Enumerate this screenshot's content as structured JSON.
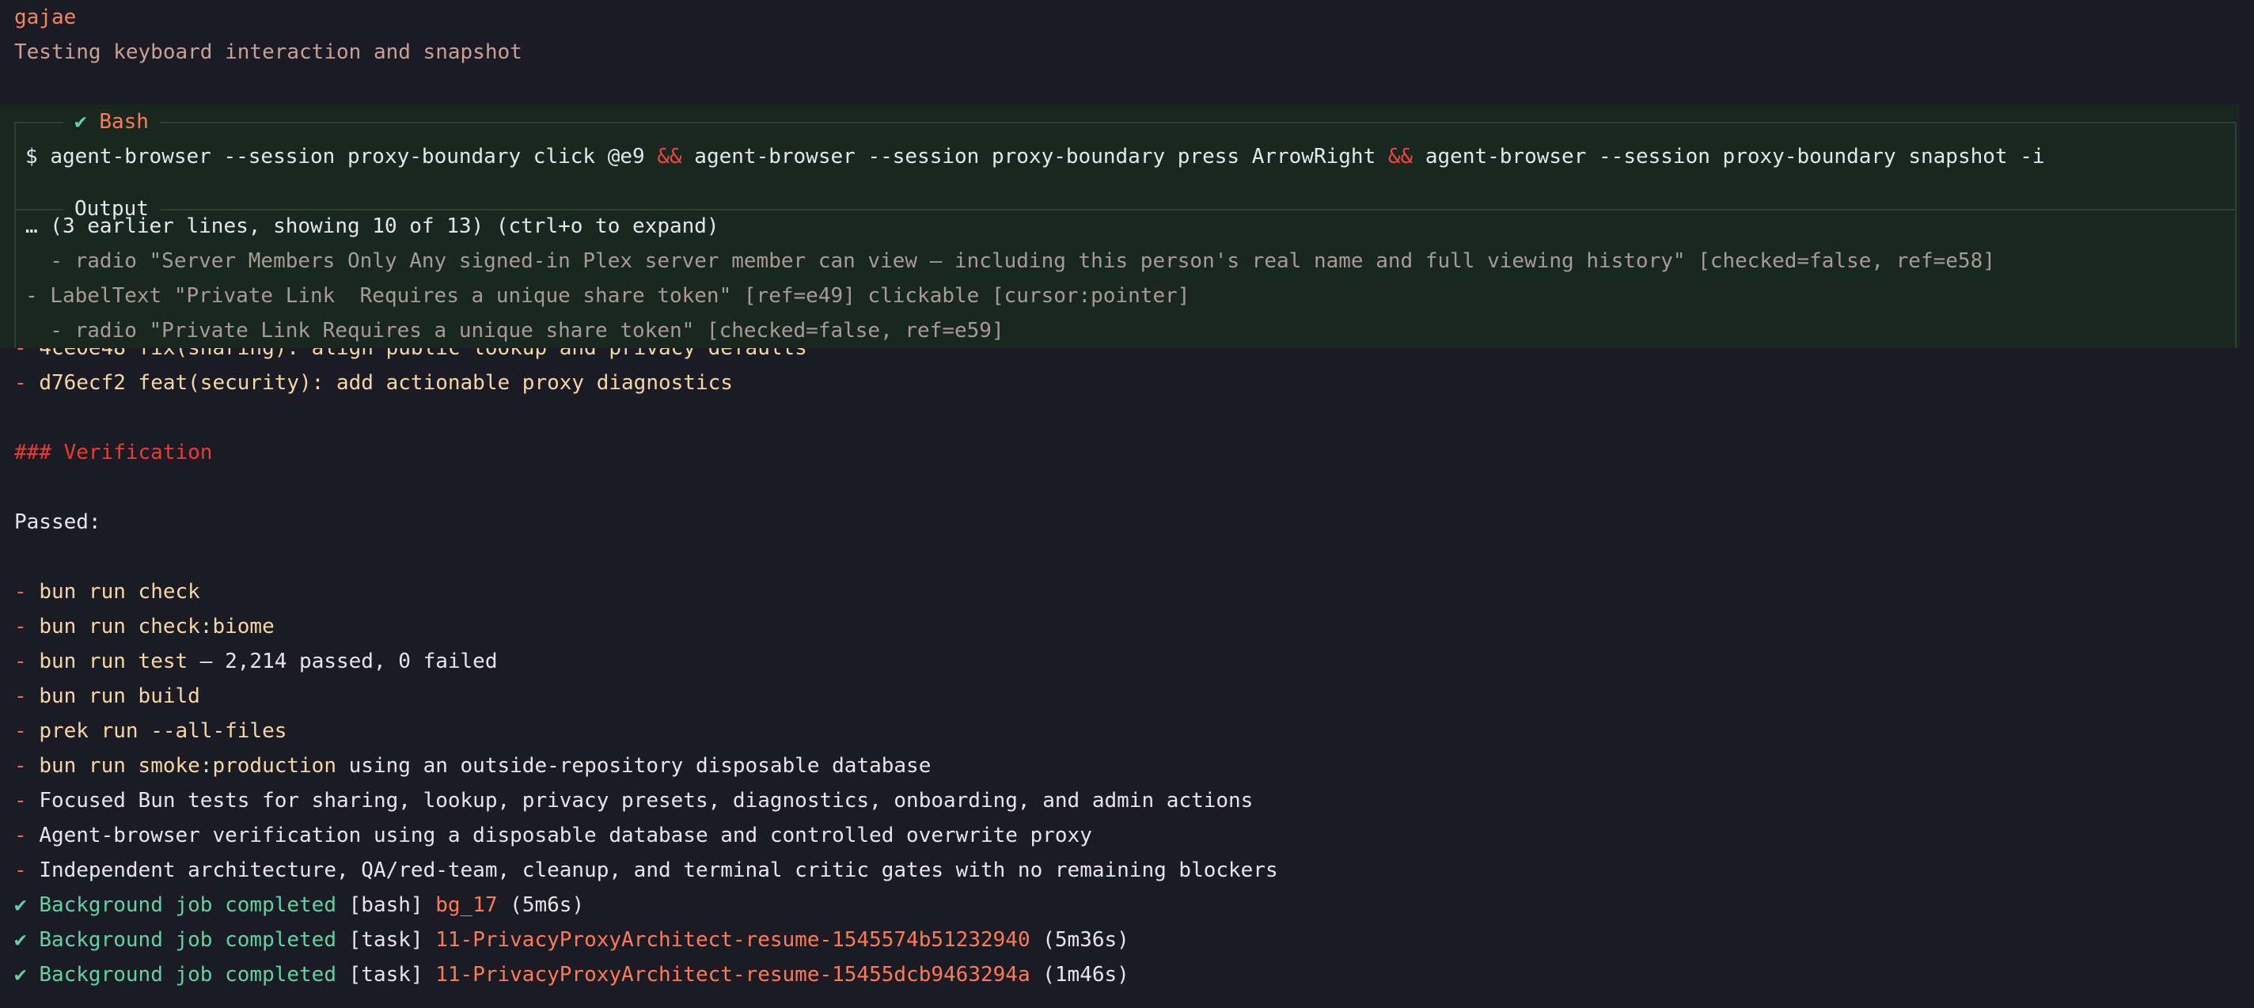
{
  "header": {
    "user": "gajae",
    "status": "Testing keyboard interaction and snapshot"
  },
  "tool": {
    "check": "✔",
    "name": "Bash",
    "output_label": "Output",
    "prompt": "$",
    "command_parts": [
      "agent-browser --session proxy-boundary click @e9",
      "&&",
      "agent-browser --session proxy-boundary press ArrowRight",
      "&&",
      "agent-browser --session proxy-boundary snapshot -i"
    ],
    "output_lines": [
      "… (3 earlier lines, showing 10 of 13) (ctrl+o to expand)",
      "  - radio \"Server Members Only Any signed-in Plex server member can view — including this person's real name and full viewing history\" [checked=false, ref=e58]",
      "- LabelText \"Private Link  Requires a unique share token\" [ref=e49] clickable [cursor:pointer]",
      "  - radio \"Private Link Requires a unique share token\" [checked=false, ref=e59]"
    ]
  },
  "commits": [
    "4ce0e48 fix(sharing): align public lookup and privacy defaults",
    "d76ecf2 feat(security): add actionable proxy diagnostics"
  ],
  "verification": {
    "heading": "### Verification",
    "passed_label": "Passed:",
    "items": [
      {
        "cmd": "bun run check",
        "rest": ""
      },
      {
        "cmd": "bun run check:biome",
        "rest": ""
      },
      {
        "cmd": "bun run test",
        "rest": " — 2,214 passed, 0 failed"
      },
      {
        "cmd": "bun run build",
        "rest": ""
      },
      {
        "cmd": "prek run --all-files",
        "rest": ""
      },
      {
        "cmd": "bun run smoke:production",
        "rest": " using an outside-repository disposable database"
      },
      {
        "cmd": "",
        "rest": "Focused Bun tests for sharing, lookup, privacy presets, diagnostics, onboarding, and admin actions"
      },
      {
        "cmd": "",
        "rest": "Agent-browser verification using a disposable database and controlled overwrite proxy"
      },
      {
        "cmd": "",
        "rest": "Independent architecture, QA/red-team, cleanup, and terminal critic gates with no remaining blockers"
      }
    ]
  },
  "jobs": [
    {
      "check": "✔",
      "label": "Background job completed",
      "kind": "[bash]",
      "id": "bg_17",
      "time": "(5m6s)"
    },
    {
      "check": "✔",
      "label": "Background job completed",
      "kind": "[task]",
      "id": "11-PrivacyProxyArchitect-resume-1545574b51232940",
      "time": "(5m36s)"
    },
    {
      "check": "✔",
      "label": "Background job completed",
      "kind": "[task]",
      "id": "11-PrivacyProxyArchitect-resume-15455dcb9463294a",
      "time": "(1m46s)"
    }
  ],
  "colors": {
    "background": "#1a1b25",
    "tool_background": "#18271f",
    "accent_orange": "#ff7a52",
    "accent_green": "#5fd4a0",
    "heading_red": "#f03a30"
  }
}
